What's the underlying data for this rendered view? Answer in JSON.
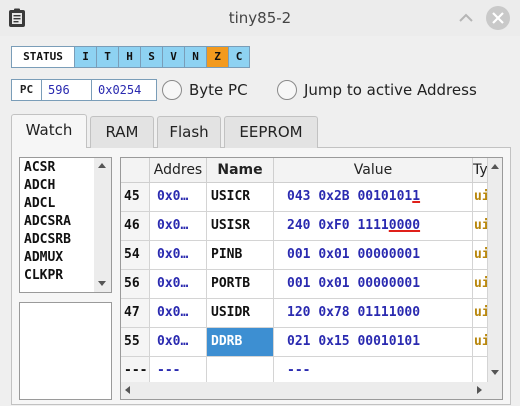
{
  "window": {
    "title": "tiny85-2",
    "app_icon": "clipboard-icon",
    "minimize_icon": "chevron-up-icon",
    "close_icon": "close-icon"
  },
  "status": {
    "label": "STATUS",
    "flags": [
      {
        "letter": "I",
        "set": false
      },
      {
        "letter": "T",
        "set": false
      },
      {
        "letter": "H",
        "set": false
      },
      {
        "letter": "S",
        "set": false
      },
      {
        "letter": "V",
        "set": false
      },
      {
        "letter": "N",
        "set": false
      },
      {
        "letter": "Z",
        "set": true
      },
      {
        "letter": "C",
        "set": false
      }
    ],
    "clear_color": "#8ed2f2",
    "set_color": "#f39a1e"
  },
  "pc": {
    "label": "PC",
    "decimal": "596",
    "hex": "0x0254",
    "byte_pc_label": "Byte PC",
    "jump_label": "Jump to active Address"
  },
  "tabs": [
    "Watch",
    "RAM",
    "Flash",
    "EEPROM"
  ],
  "active_tab": "Watch",
  "register_list": [
    "ACSR",
    "ADCH",
    "ADCL",
    "ADCSRA",
    "ADCSRB",
    "ADMUX",
    "CLKPR"
  ],
  "table": {
    "headers": {
      "address": "Addres",
      "name": "Name",
      "value": "Value",
      "type": "Ty"
    },
    "rows": [
      {
        "index": "45",
        "address": "0x0…",
        "name": "USICR",
        "dec": "043",
        "hex": "0x2B",
        "bin_plain": "0010101",
        "bin_changed": "1",
        "type": "ui"
      },
      {
        "index": "46",
        "address": "0x0…",
        "name": "USISR",
        "dec": "240",
        "hex": "0xF0",
        "bin_plain": "1111",
        "bin_changed": "0000",
        "type": "ui"
      },
      {
        "index": "54",
        "address": "0x0…",
        "name": "PINB",
        "dec": "001",
        "hex": "0x01",
        "bin_plain": "00000001",
        "bin_changed": "",
        "type": "ui"
      },
      {
        "index": "56",
        "address": "0x0…",
        "name": "PORTB",
        "dec": "001",
        "hex": "0x01",
        "bin_plain": "00000001",
        "bin_changed": "",
        "type": "ui"
      },
      {
        "index": "47",
        "address": "0x0…",
        "name": "USIDR",
        "dec": "120",
        "hex": "0x78",
        "bin_plain": "01111000",
        "bin_changed": "",
        "type": "ui"
      },
      {
        "index": "55",
        "address": "0x0…",
        "name": "DDRB",
        "dec": "021",
        "hex": "0x15",
        "bin_plain": "00010101",
        "bin_changed": "",
        "type": "ui"
      }
    ],
    "empty_row": {
      "index": "---",
      "address": "---",
      "name": "",
      "value": "---",
      "type": ""
    },
    "selected_row": 5
  }
}
